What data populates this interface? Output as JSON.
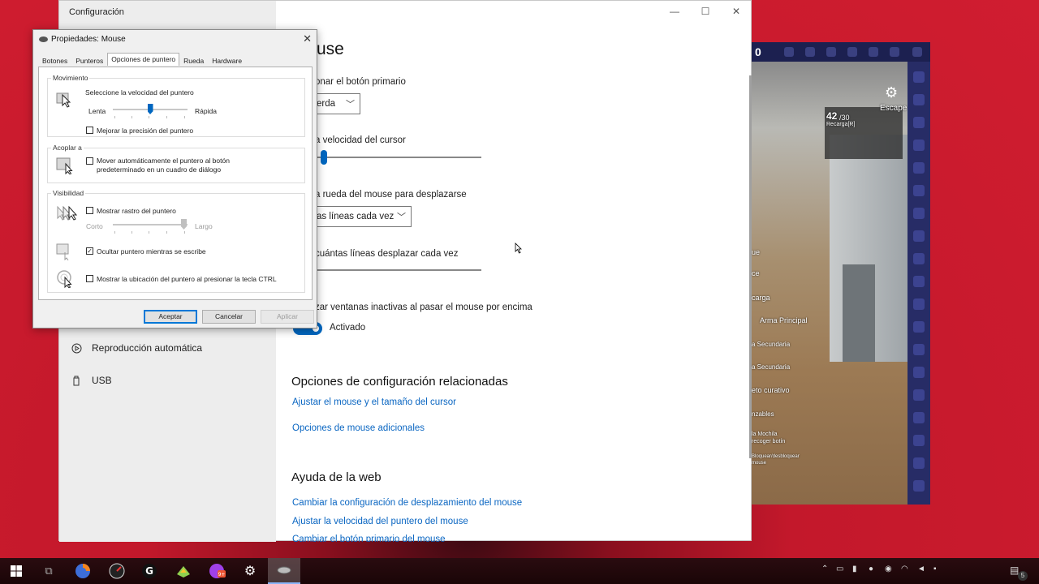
{
  "game": {
    "top_number": "0",
    "escape_label": "Escape",
    "ammo": "42",
    "ammo_total": "/30",
    "reload_label": "Recarga[R]",
    "labels": [
      "ue",
      "ce",
      "carga",
      "Arma Principal",
      "a Secundaria",
      "a Secundaria",
      "eto curativo",
      "nzables",
      "la Mochila",
      "recoger botín",
      "Bloquear/desbloquear",
      "mouse"
    ]
  },
  "settings": {
    "window_title": "Configuración",
    "page_title": "use",
    "primary_button_label": "onar el botón primario",
    "primary_button_value": "erda",
    "cursor_speed_label": "a velocidad del cursor",
    "scroll_label": "a rueda del mouse para desplazarse",
    "scroll_value": "as líneas cada vez",
    "lines_label": "cuántas líneas desplazar cada vez",
    "inactive_label": "zar ventanas inactivas al pasar el mouse por encima",
    "toggle_state": "Activado",
    "related_heading": "Opciones de configuración relacionadas",
    "related_links": [
      "Ajustar el mouse y el tamaño del cursor",
      "Opciones de mouse adicionales"
    ],
    "web_help_heading": "Ayuda de la web",
    "web_links": [
      "Cambiar la configuración de desplazamiento del mouse",
      "Ajustar la velocidad del puntero del mouse",
      "Cambiar el botón primario del mouse"
    ],
    "sidebar": [
      {
        "label": "Reproducción automática",
        "icon": "autoplay-icon"
      },
      {
        "label": "USB",
        "icon": "usb-icon"
      }
    ]
  },
  "dialog": {
    "title": "Propiedades: Mouse",
    "tabs": [
      "Botones",
      "Punteros",
      "Opciones de puntero",
      "Rueda",
      "Hardware"
    ],
    "active_tab": "Opciones de puntero",
    "motion": {
      "group": "Movimiento",
      "speed_label": "Seleccione la velocidad del puntero",
      "slow": "Lenta",
      "fast": "Rápida",
      "speed_level": 0.5,
      "precision_label": "Mejorar la precisión del puntero",
      "precision_checked": false
    },
    "snap": {
      "group": "Acoplar a",
      "label_line1": "Mover automáticamente el puntero al botón",
      "label_line2": "predeterminado en un cuadro de diálogo",
      "checked": false
    },
    "visibility": {
      "group": "Visibilidad",
      "trails_label": "Mostrar rastro del puntero",
      "trails_checked": false,
      "short": "Corto",
      "long": "Largo",
      "hide_label": "Ocultar puntero mientras se escribe",
      "hide_checked": true,
      "ctrl_label": "Mostrar la ubicación del puntero al presionar la tecla CTRL",
      "ctrl_checked": false
    },
    "buttons": {
      "ok": "Aceptar",
      "cancel": "Cancelar",
      "apply": "Aplicar"
    }
  },
  "taskbar": {
    "icons": [
      "windows-start-icon",
      "task-view-icon",
      "firefox-icon",
      "speedometer-icon",
      "logitech-g-icon",
      "bluestacks-icon",
      "messenger-icon",
      "settings-gear-icon",
      "mouse-icon"
    ],
    "notification_count": "5"
  }
}
